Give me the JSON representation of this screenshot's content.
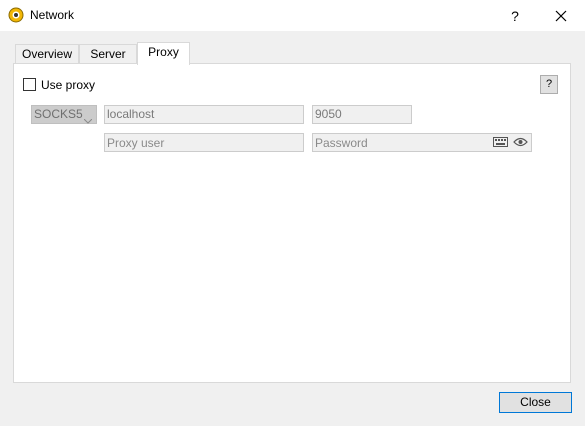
{
  "window": {
    "title": "Network",
    "help_label": "?"
  },
  "tabs": [
    {
      "label": "Overview"
    },
    {
      "label": "Server"
    },
    {
      "label": "Proxy"
    }
  ],
  "proxy": {
    "use_proxy_label": "Use proxy",
    "use_proxy_checked": false,
    "help_label": "?",
    "type_value": "SOCKS5",
    "host_value": "localhost",
    "port_value": "9050",
    "user_placeholder": "Proxy user",
    "password_placeholder": "Password"
  },
  "footer": {
    "close_label": "Close"
  },
  "colors": {
    "accent": "#0078d7",
    "app_icon": "#f2b705"
  }
}
